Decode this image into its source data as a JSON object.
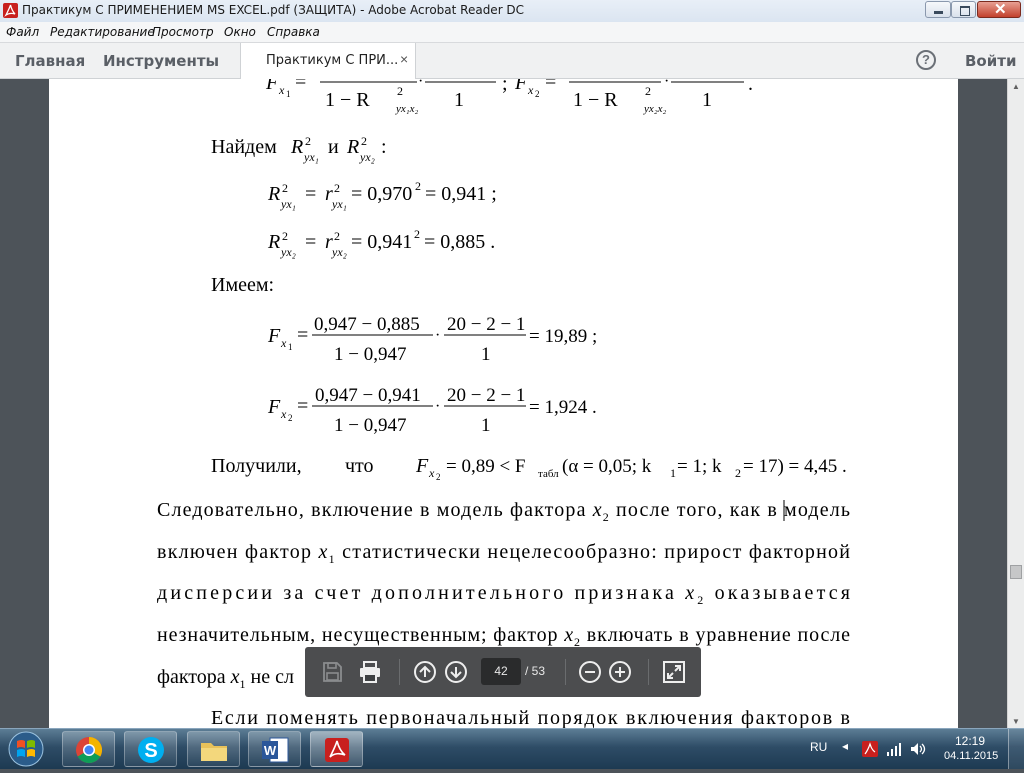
{
  "window": {
    "title": "Практикум С ПРИМЕНЕНИЕМ MS EXCEL.pdf (ЗАЩИТА) - Adobe Acrobat Reader DC"
  },
  "menu": [
    "Файл",
    "Редактирование",
    "Просмотр",
    "Окно",
    "Справка"
  ],
  "toolbar": {
    "home": "Главная",
    "tools": "Инструменты",
    "doc_tab": "Практикум С ПРИ...",
    "close": "×",
    "help": "?",
    "signin": "Войти"
  },
  "document": {
    "top_formula": {
      "fx1": "F",
      "fx1_sub": "x",
      "fx1_subsub": "1",
      "denom1": "1 − R",
      "denom1_sup": "2",
      "denom1_sub": "yx₁x₂",
      "one": "1",
      "semicolon": ";",
      "fx2": "F",
      "fx2_sub": "x",
      "fx2_subsub": "2",
      "denom2": "1 − R",
      "denom2_sup": "2",
      "denom2_sub": "yx₂x₂",
      "end": "."
    },
    "find_line": {
      "prefix": "Найдем",
      "and": "и",
      "suffix": ":"
    },
    "r1": {
      "lhs_sub": "yx₁",
      "rhs_sub": "yx₁",
      "value": "= 0,970",
      "exp": "2",
      "result": "= 0,941 ;"
    },
    "r2": {
      "lhs_sub": "yx₂",
      "rhs_sub": "yx₂",
      "value": "= 0,941",
      "exp": "2",
      "result": "= 0,885 ."
    },
    "have": "Имеем:",
    "f1": {
      "num1": "0,947 − 0,885",
      "den1": "1 − 0,947",
      "num2": "20 − 2 − 1",
      "den2": "1",
      "result": "= 19,89 ;"
    },
    "f2": {
      "num1": "0,947 − 0,941",
      "den1": "1 − 0,947",
      "num2": "20 − 2 − 1",
      "den2": "1",
      "result": "= 1,924 ."
    },
    "got": {
      "word1": "Получили,",
      "word2": "что",
      "expr": "= 0,89 < F",
      "table": "табл",
      "cond": "(α = 0,05;  k",
      "k1": "1",
      "cond2": " = 1;  k",
      "k2": "2",
      "cond3": " = 17) = 4,45 ."
    },
    "para": [
      [
        "Следовательно, включение в модель фактора ",
        "x",
        "2",
        " после того, как в модель"
      ],
      [
        "включен фактор ",
        "x",
        "1",
        " статистически нецелесообразно: прирост факторной"
      ],
      [
        "дисперсии за счет дополнительного признака ",
        "x",
        "2",
        " оказывается"
      ],
      [
        "незначительным, несущественным; фактор ",
        "x",
        "2",
        " включать в уравнение после"
      ],
      [
        "фактора ",
        "x",
        "1",
        " не сл"
      ]
    ],
    "last_line": "Если поменять первоначальный порядок включения факторов в"
  },
  "floating_toolbar": {
    "page_current": "42",
    "page_total": "/  53"
  },
  "taskbar": {
    "language": "RU",
    "time": "12:19",
    "date": "04.11.2015"
  },
  "colors": {
    "pdf_red": "#c8201e",
    "background": "#4d5359",
    "taskbar": "#2e4c66"
  }
}
